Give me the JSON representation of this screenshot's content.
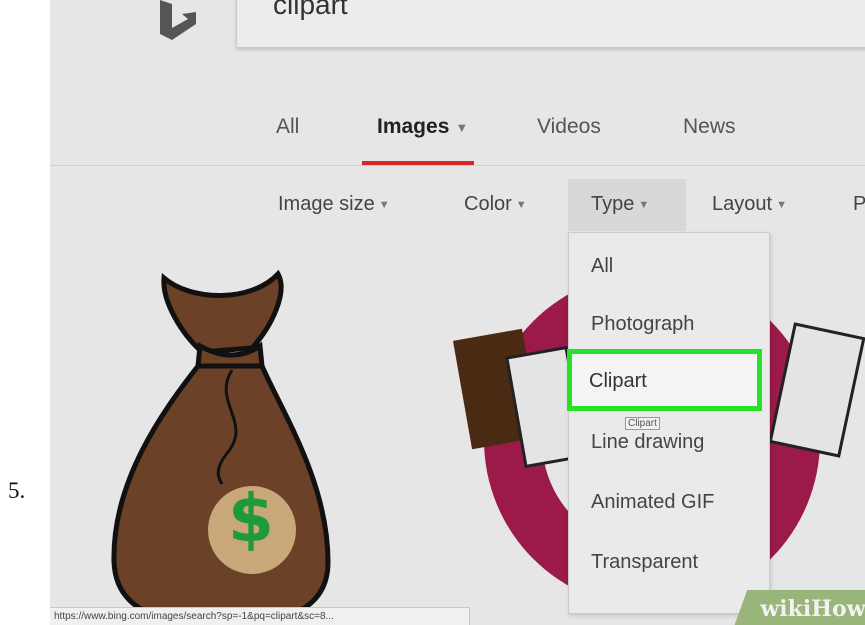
{
  "step_number": "5.",
  "search": {
    "query": "clipart"
  },
  "tabs": [
    {
      "label": "All"
    },
    {
      "label": "Images"
    },
    {
      "label": "Videos"
    },
    {
      "label": "News"
    }
  ],
  "filters": [
    {
      "label": "Image size"
    },
    {
      "label": "Color"
    },
    {
      "label": "Type"
    },
    {
      "label": "Layout"
    },
    {
      "label": "P"
    }
  ],
  "type_dropdown": {
    "items": [
      {
        "label": "All"
      },
      {
        "label": "Photograph"
      },
      {
        "label": "Clipart"
      },
      {
        "label": "Line drawing"
      },
      {
        "label": "Animated GIF"
      },
      {
        "label": "Transparent"
      }
    ],
    "tooltip": "Clipart"
  },
  "status_url": "https://www.bing.com/images/search?sp=-1&pq=clipart&sc=8...",
  "money_symbol": "$",
  "watermark": "wikiHow",
  "colors": {
    "accent_underline": "#d62b23",
    "highlight_border": "#28e028",
    "money_bag": "#6b4127",
    "dollar": "#1e9a3a",
    "handshake_circle": "#9b1a4a"
  }
}
